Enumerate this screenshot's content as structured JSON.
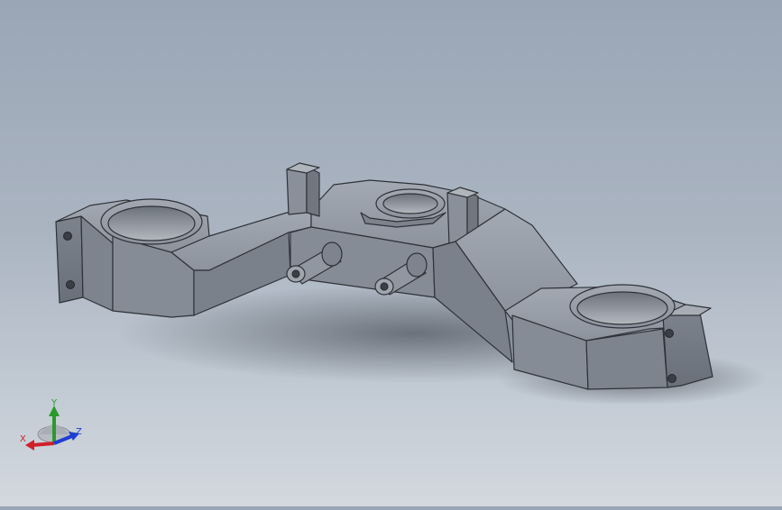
{
  "view": {
    "background_top": "#9aa6b6",
    "background_bottom": "#d3d8de",
    "model_color": "#8a919c"
  },
  "triad": {
    "x_label": "X",
    "y_label": "Y",
    "z_label": "Z",
    "x_color": "#d0202a",
    "y_color": "#2a9a2a",
    "z_color": "#1f3fd0"
  }
}
